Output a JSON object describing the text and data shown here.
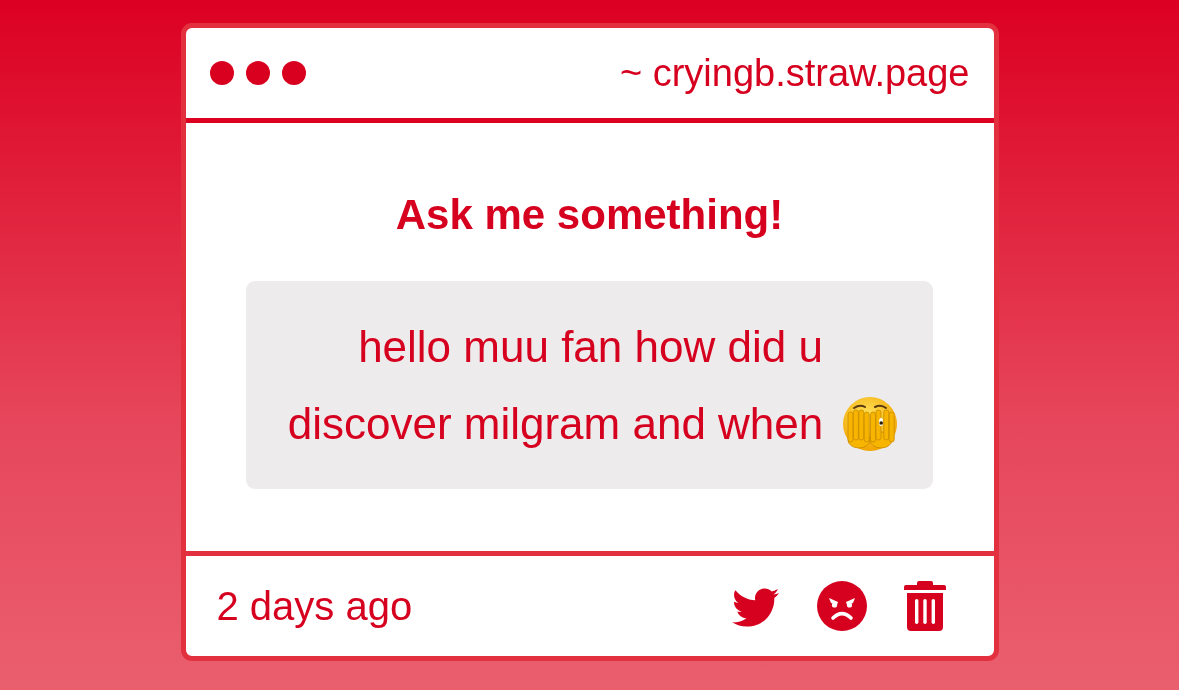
{
  "window": {
    "address": "~ cryingb.straw.page"
  },
  "prompt": {
    "title": "Ask me something!"
  },
  "question": {
    "text": "hello muu fan how did u discover milgram and when"
  },
  "footer": {
    "time": "2 days ago",
    "actions": [
      {
        "kind": "bird"
      },
      {
        "kind": "angry-face"
      },
      {
        "kind": "trash"
      }
    ]
  }
}
